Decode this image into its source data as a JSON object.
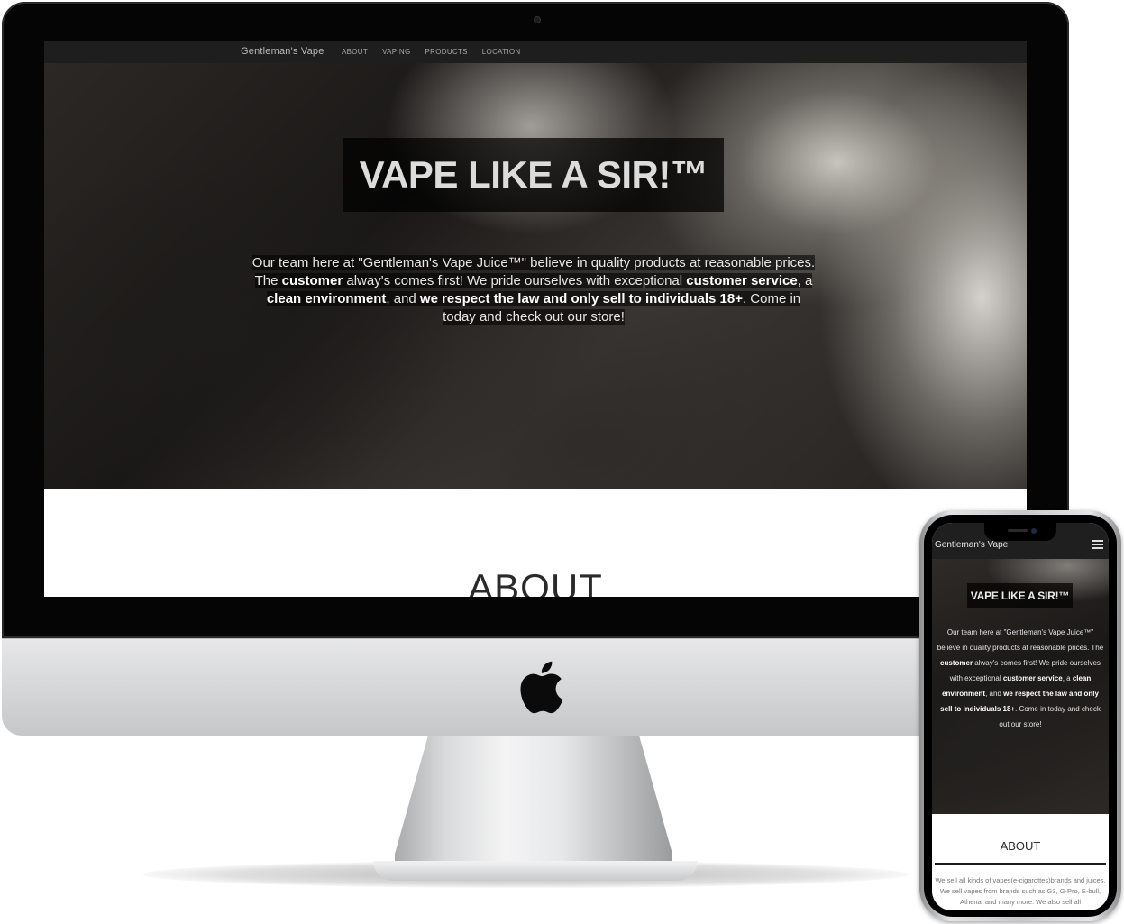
{
  "desktop": {
    "brand": "Gentleman's Vape",
    "nav": [
      "ABOUT",
      "VAPING",
      "PRODUCTS",
      "LOCATION"
    ],
    "hero_title": "VAPE LIKE A SIR!™",
    "hero_text": {
      "p1": "Our team here at \"Gentleman's Vape Juice™\" believe in quality products at reasonable prices. The ",
      "b1": "customer",
      "p2": " alway's comes first! We pride ourselves with exceptional ",
      "b2": "customer service",
      "p3": ", a ",
      "b3": "clean environment",
      "p4": ", and ",
      "b4": "we respect the law and only sell to individuals 18+",
      "p5": ". Come in today and check out our store!"
    },
    "about_heading": "ABOUT"
  },
  "mobile": {
    "brand": "Gentleman's Vape",
    "hero_title": "VAPE LIKE A SIR!™",
    "about_heading": "ABOUT",
    "about_text": "We sell all kinds of vapes(e-cigarottes)brands and juices. We sell vapes from brands such as G3, G-Pro, E-bull, Athena, and many more. We also sell all"
  },
  "icons": {
    "apple": "apple-logo-icon",
    "menu": "hamburger-menu-icon"
  },
  "colors": {
    "nav_bg": "#1e1e1e",
    "hero_overlay": "#000000",
    "page_bg": "#ffffff"
  }
}
